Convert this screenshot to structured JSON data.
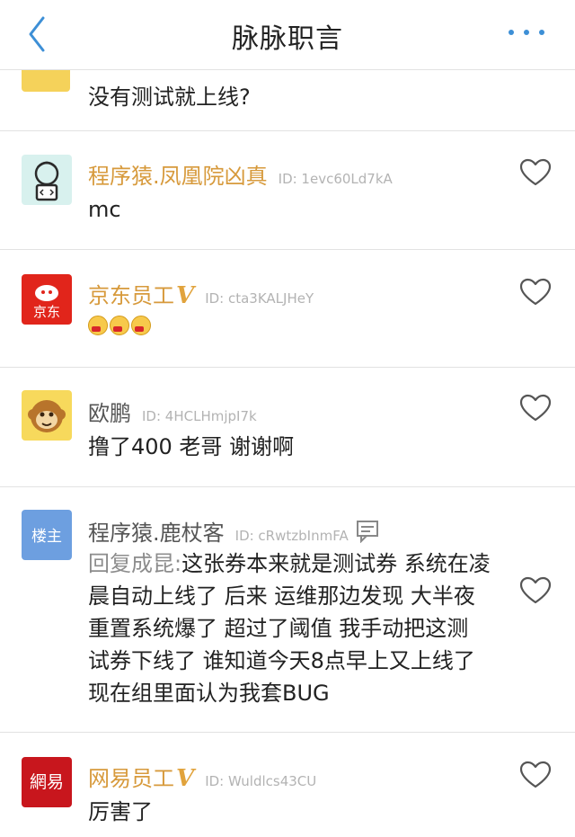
{
  "header": {
    "title": "脉脉职言"
  },
  "partial_comment": {
    "text": "没有测试就上线?"
  },
  "comments": [
    {
      "name": "程序猿.凤凰院凶真",
      "id_label": "ID: 1evc60Ld7kA",
      "text": "mc"
    },
    {
      "name": "京东员工",
      "verified": "V",
      "id_label": "ID: cta3KALJHeY",
      "avatar_text": "京东"
    },
    {
      "name": "欧鹏",
      "id_label": "ID: 4HCLHmjpI7k",
      "text": "撸了400 老哥 谢谢啊"
    },
    {
      "name": "程序猿.鹿杖客",
      "id_label": "ID: cRwtzbInmFA",
      "avatar_text": "楼主",
      "reply_prefix": "回复成昆:",
      "lines": [
        "这张券本来就是测试券 系统在凌",
        "晨自动上线了 后来 运维那边发现 大半夜",
        "重置系统爆了 超过了阈值  我手动把这测",
        "试券下线了 谁知道今天8点早上又上线了",
        "现在组里面认为我套BUG"
      ]
    },
    {
      "name": "网易员工",
      "verified": "V",
      "id_label": "ID: Wuldlcs43CU",
      "avatar_text": "網易",
      "text": "厉害了"
    }
  ],
  "colors": {
    "accent_blue": "#3d8fd6",
    "name_orange": "#d79a3c",
    "jd_red": "#e1251b",
    "netease_red": "#c8161d",
    "host_blue": "#6d9fe0"
  }
}
